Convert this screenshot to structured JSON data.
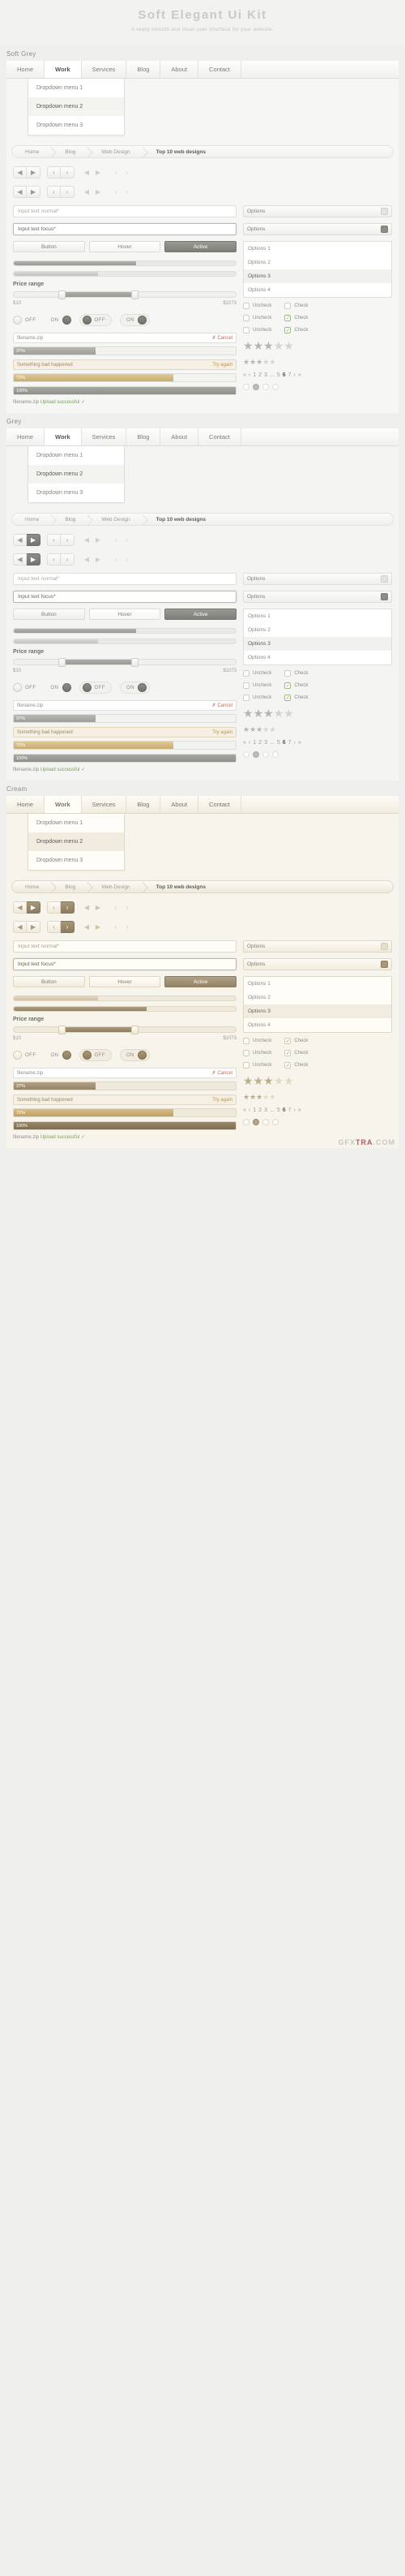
{
  "hero": {
    "title": "Soft Elegant Ui Kit",
    "subtitle": "A really smooth and clean user interface for your website."
  },
  "sections": [
    {
      "label": "Soft Grey",
      "theme": "softgrey"
    },
    {
      "label": "Grey",
      "theme": "grey"
    },
    {
      "label": "Cream",
      "theme": "cream"
    }
  ],
  "nav": {
    "items": [
      "Home",
      "Work",
      "Services",
      "Blog",
      "About",
      "Contact"
    ],
    "active": "Work"
  },
  "dropdown": {
    "items": [
      "Dropdown menu 1",
      "Dropdown menu 2",
      "Dropdown menu 3"
    ],
    "selected": "Dropdown menu 2"
  },
  "breadcrumb": {
    "items": [
      "Home",
      "Blog",
      "Web Design",
      "Top 10 web designs"
    ]
  },
  "arrows": {
    "prev": "◀",
    "next": "▶",
    "chev_left": "‹",
    "chev_right": "›"
  },
  "inputs": {
    "normal": "Input text normal*",
    "focus": "Input text focus*"
  },
  "buttons": {
    "normal": "Button",
    "hover": "Hover",
    "active": "Active"
  },
  "price": {
    "title": "Price range",
    "min": "$10",
    "max": "$1073"
  },
  "toggles": [
    {
      "label": "OFF",
      "state": "off",
      "style": "plain"
    },
    {
      "label": "ON",
      "state": "on",
      "style": "plain"
    },
    {
      "label": "OFF",
      "state": "off",
      "style": "pill"
    },
    {
      "label": "ON",
      "state": "on",
      "style": "pill"
    }
  ],
  "checkboxes": {
    "rows": [
      {
        "left": "Uncheck",
        "right": "Check",
        "right_on": false
      },
      {
        "left": "Uncheck",
        "right": "Check",
        "right_on": true
      },
      {
        "left": "Uncheck",
        "right": "Check",
        "right_on": true
      }
    ],
    "mark": "✓"
  },
  "options": {
    "header_light": "Options",
    "header_dark": "Options",
    "items": [
      "Options 1",
      "Options 2",
      "Options 3",
      "Options 4"
    ],
    "selected": "Options 3"
  },
  "rating": {
    "filled": 3,
    "total": 5,
    "glyph": "★"
  },
  "pagination": {
    "first": "«",
    "prev": "‹",
    "pages": [
      "1",
      "2",
      "3",
      "...",
      "5",
      "6",
      "7"
    ],
    "current": "6",
    "next": "›",
    "last": "»"
  },
  "upload": {
    "filename": "filename.zip",
    "cancel": "✗ Cancel",
    "progress_1": "37%",
    "warn_text": "Something bad happened",
    "warn_action": "Try again",
    "progress_2": "72%",
    "progress_3": "100%",
    "success": "Upload successful",
    "success_mark": "✓"
  },
  "dots": {
    "count": 4,
    "active_index": 1
  },
  "watermark": {
    "pre": "GFX",
    "accent": "TRA",
    "post": ".COM"
  }
}
